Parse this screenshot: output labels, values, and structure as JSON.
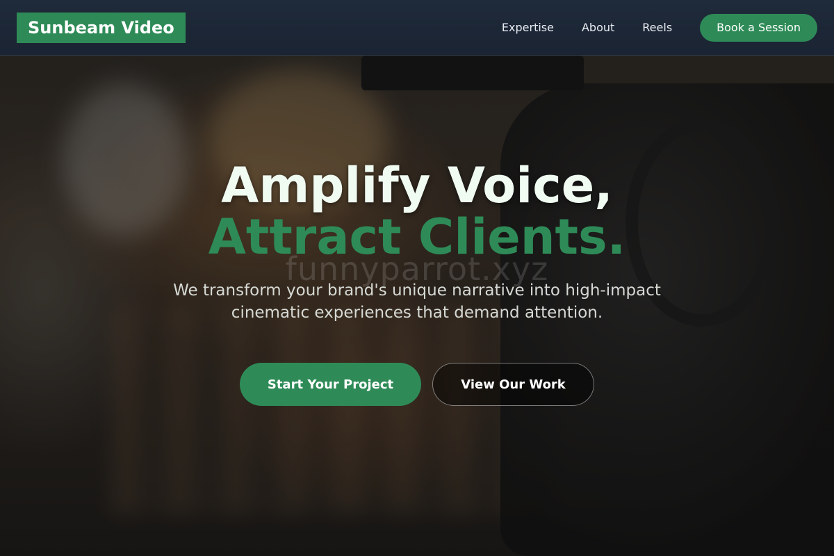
{
  "brand": {
    "name": "Sunbeam Video",
    "accent_color": "#2e8b57"
  },
  "nav": {
    "links": [
      "Expertise",
      "About",
      "Reels"
    ],
    "cta_label": "Book a Session"
  },
  "hero": {
    "headline_line1": "Amplify Voice,",
    "headline_line2": "Attract Clients.",
    "watermark": "funnyparrot.xyz",
    "subtitle": "We transform your brand's unique narrative into high-impact cinematic experiences that demand attention.",
    "primary_cta": "Start Your Project",
    "secondary_cta": "View Our Work"
  }
}
